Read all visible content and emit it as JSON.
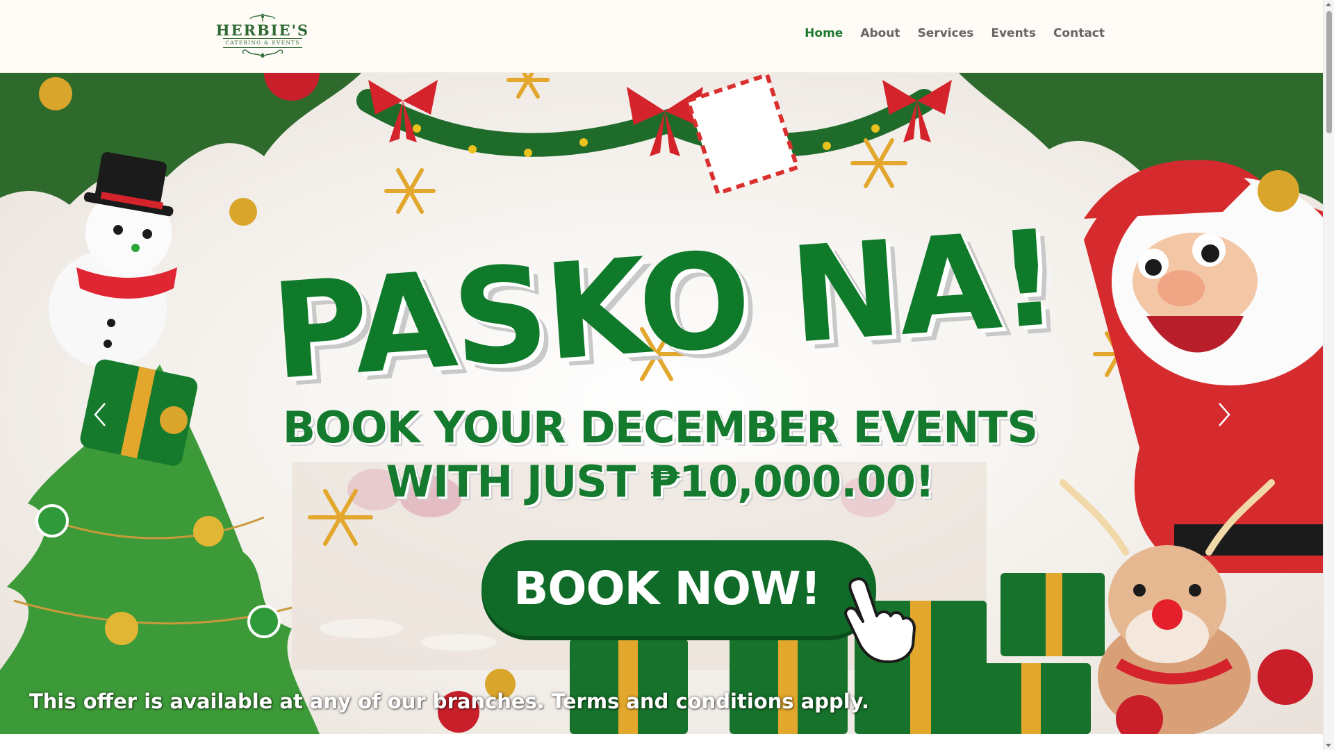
{
  "header": {
    "logo": {
      "title": "HERBIE'S",
      "subtitle": "CATERING & EVENTS",
      "icon": "ornamental-flourish"
    },
    "nav": [
      {
        "label": "Home",
        "active": true
      },
      {
        "label": "About",
        "active": false
      },
      {
        "label": "Services",
        "active": false
      },
      {
        "label": "Events",
        "active": false
      },
      {
        "label": "Contact",
        "active": false
      }
    ]
  },
  "hero": {
    "headline": "PASKO NA!",
    "line1": "BOOK YOUR DECEMBER EVENTS",
    "line2": "WITH JUST ₱10,000.00!",
    "cta_label": "BOOK NOW!",
    "fine_print": "This offer is available at any of our branches. Terms and conditions apply.",
    "prev_icon": "chevron-left-icon",
    "next_icon": "chevron-right-icon",
    "decorations": [
      "snowman",
      "santa-claus",
      "reindeer",
      "christmas-tree",
      "gift-boxes",
      "garland-with-bows",
      "snowflakes",
      "ornaments"
    ]
  },
  "colors": {
    "brand_green": "#0f7a2a",
    "nav_active": "#1e7a2f",
    "nav_text": "#666666",
    "header_bg": "#fffbf6",
    "gold": "#d9a52b",
    "red": "#d4232b"
  }
}
